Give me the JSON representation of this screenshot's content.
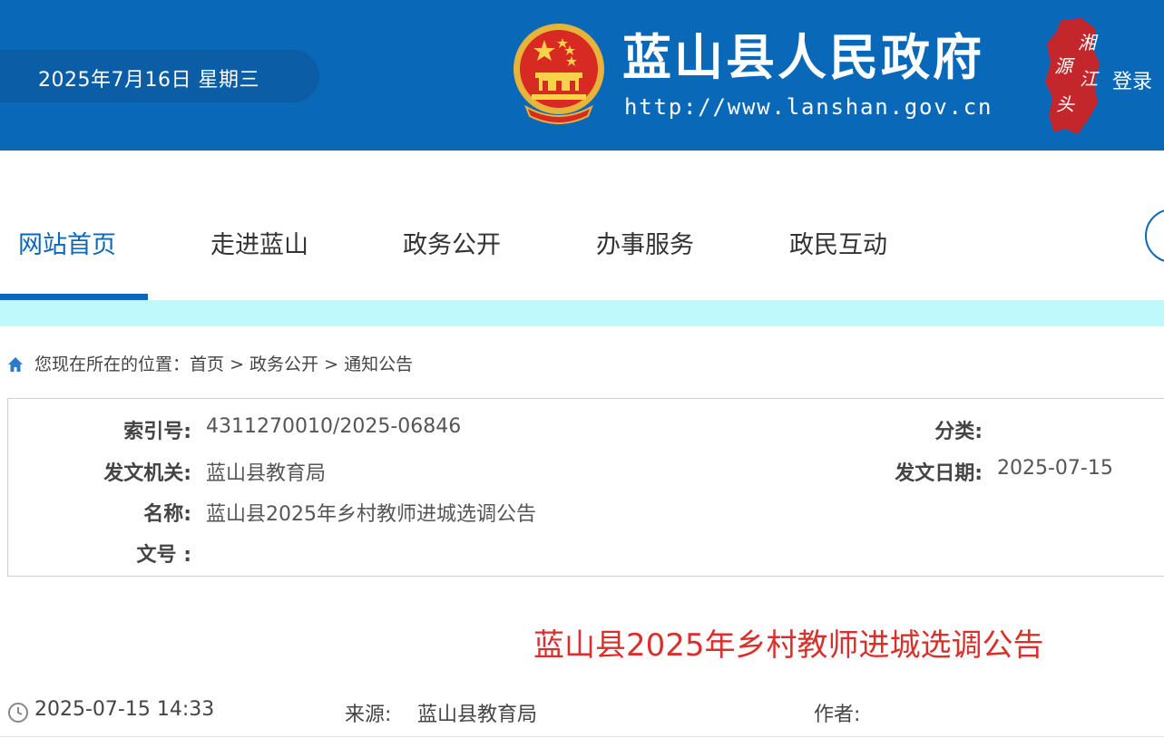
{
  "header": {
    "date": "2025年7月16日 星期三",
    "site_title": "蓝山县人民政府",
    "site_url": "http://www.lanshan.gov.cn",
    "logo_text": [
      "湘",
      "江",
      "源",
      "头"
    ],
    "login_label": "登录"
  },
  "nav": {
    "items": [
      {
        "label": "网站首页",
        "active": true
      },
      {
        "label": "走进蓝山",
        "active": false
      },
      {
        "label": "政务公开",
        "active": false
      },
      {
        "label": "办事服务",
        "active": false
      },
      {
        "label": "政民互动",
        "active": false
      }
    ]
  },
  "breadcrumb": {
    "prefix": "您现在所在的位置：",
    "items": [
      "首页",
      "政务公开",
      "通知公告"
    ],
    "separator": ">"
  },
  "info": {
    "index_label": "索引号:",
    "index_value": "4311270010/2025-06846",
    "category_label": "分类:",
    "category_value": "",
    "issuer_label": "发文机关:",
    "issuer_value": "蓝山县教育局",
    "date_label": "发文日期:",
    "date_value": "2025-07-15",
    "name_label": "名称:",
    "name_value": "蓝山县2025年乡村教师进城选调公告",
    "docno_label": "文号 :",
    "docno_value": ""
  },
  "article": {
    "title": "蓝山县2025年乡村教师进城选调公告",
    "datetime": "2025-07-15 14:33",
    "source_label": "来源:",
    "source_value": "蓝山县教育局",
    "author_label": "作者:",
    "author_value": ""
  },
  "colors": {
    "header_bg": "#0a68b8",
    "accent": "#0a68b8",
    "title_red": "#d9302c",
    "cyan_bar": "#bff9fb"
  },
  "icons": {
    "home": "home-icon",
    "clock": "clock-icon",
    "emblem": "national-emblem-icon",
    "search": "search-icon"
  }
}
